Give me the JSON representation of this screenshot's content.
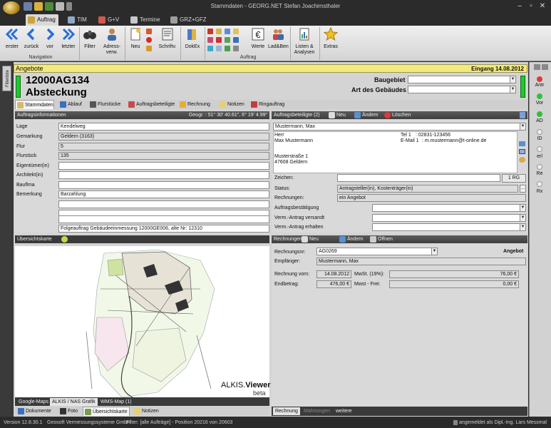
{
  "window": {
    "title": "Stammdaten - GEORG.NET Stefan Joachimsthaler"
  },
  "tabs": [
    {
      "label": "Auftrag",
      "active": true
    },
    {
      "label": "TIM"
    },
    {
      "label": "G+V"
    },
    {
      "label": "Termine"
    },
    {
      "label": "GRZ+GFZ"
    }
  ],
  "ribbon": {
    "nav_buttons": [
      {
        "label": "erster",
        "icon": "double-chevron-left-icon"
      },
      {
        "label": "zurück",
        "icon": "chevron-left-icon"
      },
      {
        "label": "vor",
        "icon": "chevron-right-icon"
      },
      {
        "label": "letzter",
        "icon": "double-chevron-right-icon"
      }
    ],
    "navigation_group": "Navigation",
    "filter_label": "Filter",
    "adress_label_1": "Adress-",
    "adress_label_2": "verw.",
    "neu_label": "Neu",
    "schriftv_label": "Schriftv.",
    "dokex_label": "DokEx",
    "auftrag_group": "Auftrag",
    "werte_label": "Werte",
    "ladben_label": "Lad&Ben",
    "listen_label_1": "Listen &",
    "listen_label_2": "Analysen",
    "extras_label": "Extras"
  },
  "sidebar_left": {
    "vtab": "Filterliste"
  },
  "header": {
    "title": "Angebote",
    "eingang": "Eingang 14.08.2012",
    "auftrag_nr": "12000AG134",
    "auftrag_name": "Absteckung",
    "baugebiet_label": "Baugebiet",
    "baugebiet_value": "",
    "gebaeude_label": "Art des Gebäudes",
    "gebaeude_value": ""
  },
  "subtabs": [
    {
      "label": "Stammdaten",
      "active": true
    },
    {
      "label": "Ablauf"
    },
    {
      "label": "Flurstücke"
    },
    {
      "label": "Auftragsbeteiligte"
    },
    {
      "label": "Rechnung"
    },
    {
      "label": "Notizen"
    },
    {
      "label": "Ringauftrag"
    }
  ],
  "auftragsinfo": {
    "title": "Auftragsinformationen",
    "geo": "Geogr. : 51° 30' 40.61\",  6° 19' 4.99\"",
    "rows": [
      {
        "label": "Lage",
        "value": "Kendelweg"
      },
      {
        "label": "Gemarkung",
        "value": "Geldern (3163)"
      },
      {
        "label": "Flur",
        "value": "5"
      },
      {
        "label": "Flurstück",
        "value": "135"
      },
      {
        "label": "Eigentümer(in)",
        "value": ""
      },
      {
        "label": "Architekt(in)",
        "value": ""
      },
      {
        "label": "Bauflma",
        "value": ""
      },
      {
        "label": "Bemerkung",
        "value": "Barzahlung"
      }
    ],
    "extra_lines": [
      "",
      "",
      "",
      "Folgeauftrag Gebäudeeinmessung 12000GE006, alte Nr: 12310"
    ]
  },
  "beteiligte": {
    "title": "Auftragsbeteiligte (2)",
    "neu": "Neu",
    "aendern": "Ändern",
    "loeschen": "Löschen",
    "selected": "Mustermann, Max",
    "anrede": "Herr",
    "name": "Max Mustermann",
    "tel_label": "Tel 1",
    "tel": ":   02831-123456",
    "mail_label": "E-Mail 1",
    "mail": ":  m.mustermann@t-online.de",
    "strasse": "Musterstraße 1",
    "ort": "47608 Geldern",
    "zeichen_label": "Zeichen:",
    "zeichen_value": "",
    "rg_button": "1 RG",
    "status_label": "Status:",
    "status_value": "Antragsteller(in), Kostenträger(in)",
    "rechnungen_label": "Rechnungen:",
    "rechnungen_value": "ein Angebot",
    "auftragsbest_label": "Auftragsbestätigung",
    "vermantrag_versandt_label": "Verm.-Antrag versandt",
    "vermantrag_erhalten_label": "Verm.-Antrag erhalten"
  },
  "uebersicht": {
    "title": "Übersichtskarte",
    "alkis_brand_1": "ALKIS.",
    "alkis_brand_2": "Viewer",
    "alkis_brand_3": "beta",
    "map_tabs": [
      {
        "label": "Google-Maps"
      },
      {
        "label": "ALKIS / NAS Grafik",
        "active": true
      },
      {
        "label": "WMS-Map (1)"
      }
    ]
  },
  "rechnungen": {
    "title": "Rechnungen",
    "neu": "Neu",
    "aendern": "Ändern",
    "oeffnen": "Öffnen",
    "rechnungsnr_label": "Rechnungsnr:",
    "rechnungsnr_value": "AG0269",
    "art": "Angebot",
    "empfaenger_label": "Empfänger:",
    "empfaenger_value": "Mustermann, Max",
    "vom_label": "Rechnung vom:",
    "vom_value": "14.08.2012",
    "mwst_label": "MwSt. (19%):",
    "mwst_value": "76,00 €",
    "endbetrag_label": "Endbetrag:",
    "endbetrag_value": "476,00 €",
    "mwstfrei_label": "Mwst - Frei:",
    "mwstfrei_value": "0,00 €",
    "bottom_tabs": [
      {
        "label": "Rechnung",
        "active": true
      },
      {
        "label": "Mahnungen"
      },
      {
        "label": "weitere"
      }
    ]
  },
  "bottom_tabs": [
    {
      "label": "Dokumente"
    },
    {
      "label": "Foto"
    },
    {
      "label": "Übersichtskarte",
      "active": true
    },
    {
      "label": "Notizen"
    }
  ],
  "right_strip": [
    "Antr",
    "Vor",
    "AD",
    "ID",
    "erl",
    "Re",
    "Rx"
  ],
  "status": {
    "version": "Version 12.8.30.1",
    "company": "Geosoft Vermessungssysteme GmbH",
    "filter": "Filter: [alle Aufträge] - Position 20216 von 20603",
    "user": "angemeldet als Dipl.-Ing. Lars Messmal"
  },
  "colors": {
    "header_yellow": "#f3ea7c",
    "green_status": "#1ecb2c",
    "ribbon_blue": "#2a6fd6"
  }
}
